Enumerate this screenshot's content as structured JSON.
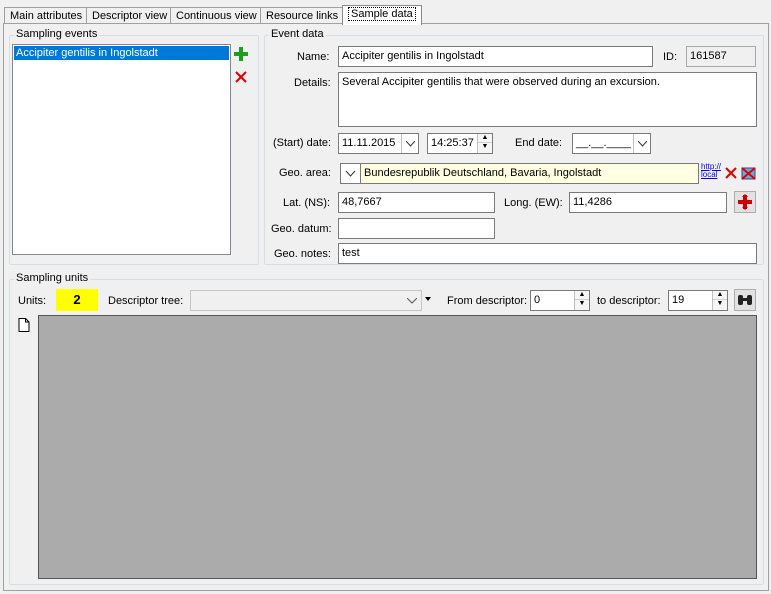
{
  "tabs": [
    {
      "label": "Main attributes"
    },
    {
      "label": "Descriptor view"
    },
    {
      "label": "Continuous view"
    },
    {
      "label": "Resource links"
    },
    {
      "label": "Sample data"
    }
  ],
  "sampling_events": {
    "title": "Sampling events",
    "items": [
      "Accipiter gentilis in Ingolstadt"
    ]
  },
  "event_data": {
    "title": "Event data",
    "name_label": "Name:",
    "name_value": "Accipiter gentilis in Ingolstadt",
    "id_label": "ID:",
    "id_value": "161587",
    "details_label": "Details:",
    "details_value": "Several Accipiter gentilis that were observed during an excursion.",
    "start_date_label": "(Start) date:",
    "start_date_value": "11.11.2015",
    "start_time_value": "14:25:37",
    "end_date_label": "End date:",
    "end_date_value": "__.__.____",
    "geo_area_label": "Geo. area:",
    "geo_area_value": "Bundesrepublik Deutschland, Bavaria, Ingolstadt",
    "geo_link_line1": "http://",
    "geo_link_line2": "local",
    "lat_label": "Lat. (NS):",
    "lat_value": "48,7667",
    "long_label": "Long. (EW):",
    "long_value": "11,4286",
    "datum_label": "Geo. datum:",
    "datum_value": "",
    "notes_label": "Geo. notes:",
    "notes_value": "test"
  },
  "sampling_units": {
    "title": "Sampling units",
    "units_label": "Units:",
    "units_value": "2",
    "descriptor_tree_label": "Descriptor tree:",
    "descriptor_tree_value": "",
    "from_label": "From descriptor:",
    "from_value": "0",
    "to_label": "to descriptor:",
    "to_value": "19"
  },
  "colors": {
    "selection": "#0078d7",
    "units_badge": "#ffff00",
    "geo_area_bg": "#ffffe1",
    "grid_bg": "#ababab",
    "add_green": "#1e9e1e",
    "delete_red": "#e00000"
  }
}
